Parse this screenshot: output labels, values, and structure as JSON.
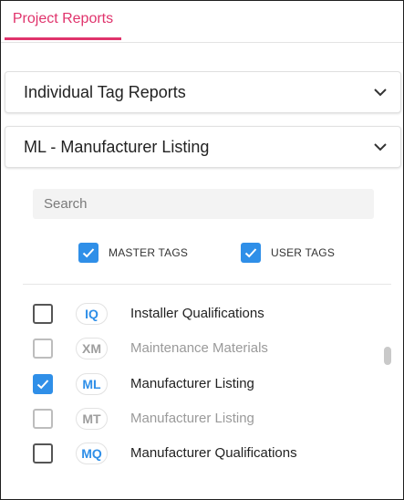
{
  "tabs": [
    {
      "label": "Project Reports",
      "active": true
    }
  ],
  "accordions": [
    {
      "title": "Individual Tag Reports",
      "icon": "chevron-down-icon"
    },
    {
      "title": "ML - Manufacturer Listing",
      "icon": "chevron-down-icon"
    }
  ],
  "search": {
    "placeholder": "Search",
    "value": ""
  },
  "filters": [
    {
      "label": "MASTER TAGS",
      "checked": true
    },
    {
      "label": "USER TAGS",
      "checked": true
    }
  ],
  "items": [
    {
      "code": "IQ",
      "name": "Installer Qualifications",
      "checked": false,
      "disabled": false
    },
    {
      "code": "XM",
      "name": "Maintenance Materials",
      "checked": false,
      "disabled": true
    },
    {
      "code": "ML",
      "name": "Manufacturer Listing",
      "checked": true,
      "disabled": false
    },
    {
      "code": "MT",
      "name": "Manufacturer Listing",
      "checked": false,
      "disabled": true
    },
    {
      "code": "MQ",
      "name": "Manufacturer Qualifications",
      "checked": false,
      "disabled": false
    }
  ],
  "colors": {
    "accent": "#e0336c",
    "checkbox": "#2f8fe8",
    "badge_active": "#2f8fe8",
    "muted": "#9e9e9e"
  }
}
